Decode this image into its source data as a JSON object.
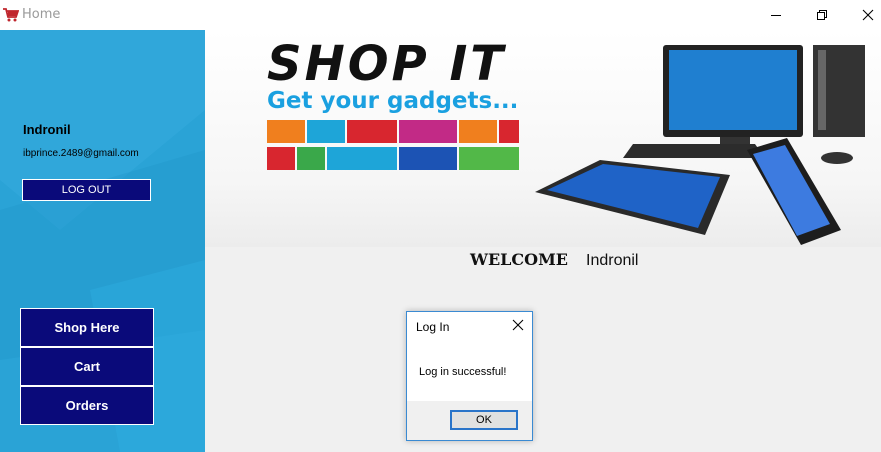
{
  "window": {
    "title": "Home",
    "icon": "cart-icon",
    "controls": [
      "minimize-icon",
      "restore-icon",
      "close-icon"
    ]
  },
  "sidebar": {
    "user_name": "Indronil",
    "user_email": "ibprince.2489@gmail.com",
    "logout_label": "LOG OUT",
    "nav": [
      {
        "label": "Shop Here"
      },
      {
        "label": "Cart"
      },
      {
        "label": "Orders"
      }
    ]
  },
  "banner": {
    "title": "SHOP IT",
    "tagline": "Get your gadgets..."
  },
  "main": {
    "welcome_label": "WELCOME",
    "welcome_name": "Indronil"
  },
  "dialog": {
    "title": "Log In",
    "message": "Log in successful!",
    "ok_label": "OK"
  },
  "colors": {
    "sidebar": "#2aa3d6",
    "button_navy": "#0a0a7a",
    "brand_blue": "#1aa0e0",
    "dialog_border": "#3a8ad2"
  }
}
